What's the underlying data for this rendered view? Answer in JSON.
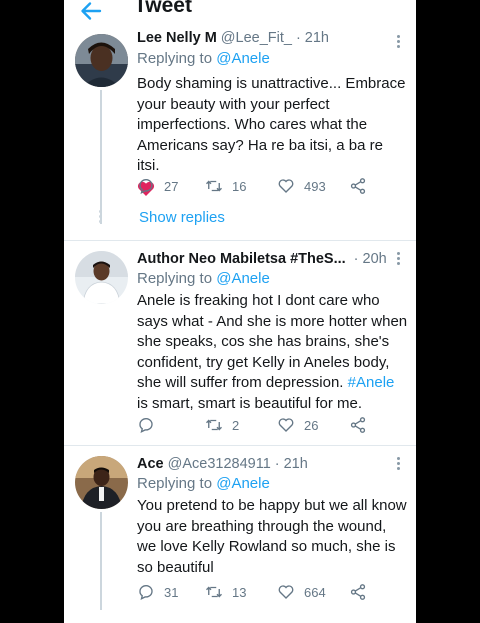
{
  "header": {
    "title": "Tweet"
  },
  "tweets": [
    {
      "name": "Lee Nelly M",
      "handle": "@Lee_Fit_",
      "time": "21h",
      "replying_prefix": "Replying to",
      "replying_to": "@Anele",
      "text": "Body shaming is unattractive... Embrace your beauty with your perfect imperfections. Who cares what the Americans say? Ha re ba itsi, a ba re itsi.",
      "replies": "27",
      "retweets": "16",
      "likes": "493",
      "show_replies": "Show replies"
    },
    {
      "name": "Author Neo Mabiletsa #TheS...",
      "time": "20h",
      "replying_prefix": "Replying to",
      "replying_to": "@Anele",
      "text_before": "Anele is freaking hot I dont care who says what - And she is more hotter when she speaks, cos she has brains, she's confident, try get Kelly in Aneles body, she will suffer from depression. ",
      "hashtag": "#Anele",
      "text_after": " is smart, smart is beautiful for me.",
      "retweets": "2",
      "likes": "26"
    },
    {
      "name": "Ace",
      "handle": "@Ace31284911",
      "time": "21h",
      "replying_prefix": "Replying to",
      "replying_to": "@Anele",
      "text": "You pretend to be happy but we all know you are breathing through the wound, we love Kelly Rowland so much, she is so beautiful",
      "replies": "31",
      "retweets": "13",
      "likes": "664"
    }
  ],
  "colors": {
    "accent": "#1da1f2",
    "muted": "#657786",
    "heart": "#e0245e"
  }
}
